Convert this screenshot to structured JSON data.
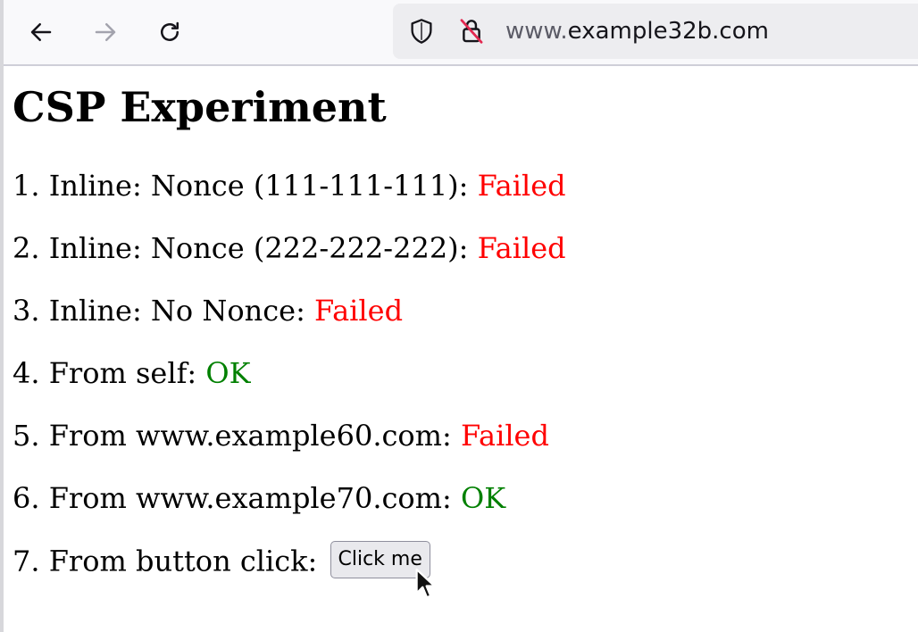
{
  "browser": {
    "url_prefix": "www.",
    "url_domain": "example32b.com"
  },
  "page": {
    "title": "CSP Experiment",
    "rows": [
      {
        "label": "1. Inline: Nonce (111-111-111): ",
        "status": "Failed"
      },
      {
        "label": "2. Inline: Nonce (222-222-222): ",
        "status": "Failed"
      },
      {
        "label": "3. Inline: No Nonce: ",
        "status": "Failed"
      },
      {
        "label": "4. From self: ",
        "status": "OK"
      },
      {
        "label": "5. From www.example60.com: ",
        "status": "Failed"
      },
      {
        "label": "6. From www.example70.com: ",
        "status": "OK"
      },
      {
        "label": "7. From button click: ",
        "button": "Click me"
      }
    ]
  },
  "colors": {
    "failed": "#ff0000",
    "ok": "#008000"
  },
  "icons": [
    "back-arrow-icon",
    "forward-arrow-icon",
    "reload-icon",
    "shield-icon",
    "insecure-lock-icon",
    "mouse-cursor-icon"
  ]
}
